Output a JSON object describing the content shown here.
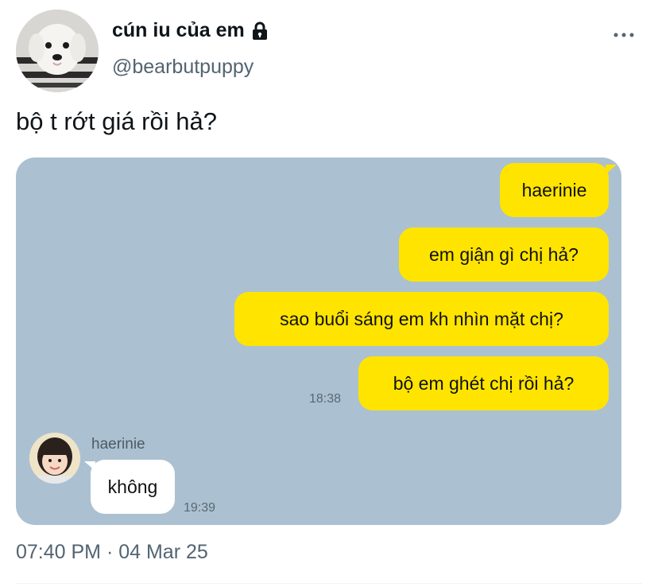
{
  "author": {
    "display_name": "cún iu của em",
    "handle": "@bearbutpuppy",
    "avatar_icon": "puppy-avatar",
    "lock_icon": "lock-icon"
  },
  "tweet": {
    "text": "bộ t rớt giá rồi hả?",
    "timestamp": "07:40 PM · 04 Mar 25"
  },
  "chat": {
    "background": "#abc1d1",
    "bubble_color": "#ffe400",
    "sent": [
      {
        "text": "haerinie"
      },
      {
        "text": "em giận gì chị hả?"
      },
      {
        "text": "sao buổi sáng em kh nhìn mặt chị?"
      },
      {
        "text": "bộ em ghét chị rồi hả?"
      }
    ],
    "sent_time": "18:38",
    "received": {
      "sender": "haerinie",
      "text": "không",
      "time": "19:39"
    }
  }
}
